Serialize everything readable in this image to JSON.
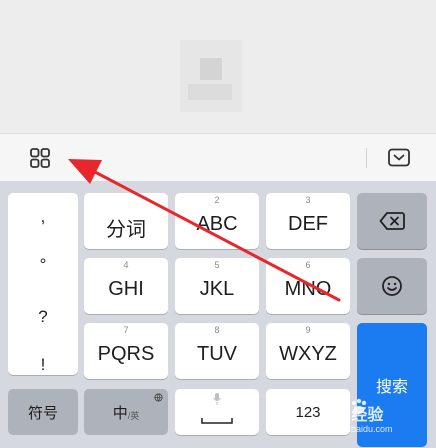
{
  "toolbar": {
    "grid_icon": "apps-grid-icon",
    "collapse_icon": "keyboard-collapse-icon"
  },
  "punctuation": [
    ",",
    "°",
    "?",
    "!"
  ],
  "keys": {
    "row1": [
      {
        "num": "",
        "label": "分词"
      },
      {
        "num": "2",
        "label": "ABC"
      },
      {
        "num": "3",
        "label": "DEF"
      }
    ],
    "row2": [
      {
        "num": "4",
        "label": "GHI"
      },
      {
        "num": "5",
        "label": "JKL"
      },
      {
        "num": "6",
        "label": "MNO"
      }
    ],
    "row3": [
      {
        "num": "7",
        "label": "PQRS"
      },
      {
        "num": "8",
        "label": "TUV"
      },
      {
        "num": "9",
        "label": "WXYZ"
      }
    ]
  },
  "functions": {
    "delete_icon": "backspace-icon",
    "emoji_icon": "smiley-icon",
    "search": "搜索"
  },
  "bottom": {
    "symbols": "符号",
    "lang_main": "中",
    "lang_sub": "/英",
    "mic_icon": "microphone-icon",
    "numbers": "123"
  },
  "watermark": {
    "main": "Bai 经验",
    "sub": "jingyan.baidu.com"
  },
  "colors": {
    "accent": "#1a7cf0",
    "arrow": "#e8262b",
    "keyboard_bg": "#d5d8de",
    "function_key": "#aeb2bb"
  }
}
